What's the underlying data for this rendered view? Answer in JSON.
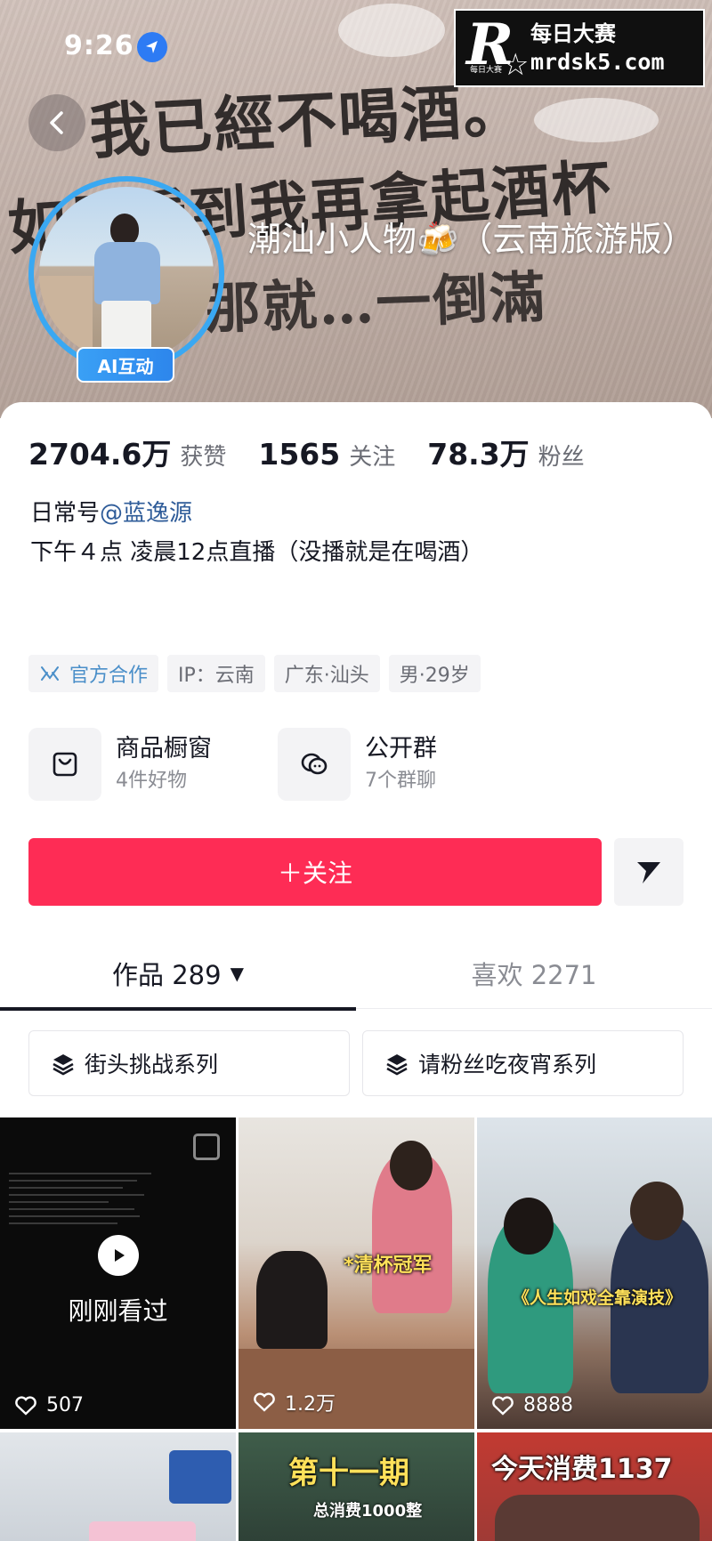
{
  "status_bar": {
    "time": "9:26"
  },
  "watermark": {
    "line1": "每日大赛",
    "line2": "mrdsk5.com",
    "logo_small": "每日大赛"
  },
  "banner": {
    "graffiti": [
      "我已經不喝酒。",
      "如果看到我再拿起酒杯",
      "那就…一倒滿"
    ],
    "nickname": "潮汕小人物🍻（云南旅游版）",
    "ai_badge": "AI互动"
  },
  "stats": [
    {
      "value": "2704.6万",
      "label": "获赞"
    },
    {
      "value": "1565",
      "label": "关注"
    },
    {
      "value": "78.3万",
      "label": "粉丝"
    }
  ],
  "profile": {
    "daily_prefix": "日常号",
    "daily_handle": "@蓝逸源",
    "bio": "下午４点 凌晨12点直播（没播就是在喝酒）"
  },
  "tags": [
    "官方合作",
    "IP：云南",
    "广东·汕头",
    "男·29岁"
  ],
  "entries": [
    {
      "title": "商品橱窗",
      "subtitle": "4件好物",
      "icon": "shop-bag-icon"
    },
    {
      "title": "公开群",
      "subtitle": "7个群聊",
      "icon": "group-chat-icon"
    }
  ],
  "actions": {
    "follow_label": "＋关注",
    "share_icon": "share-arrow-icon"
  },
  "tabs": {
    "works_label": "作品 289",
    "likes_label": "喜欢 2271"
  },
  "series": [
    "街头挑战系列",
    "请粉丝吃夜宵系列"
  ],
  "videos": [
    {
      "likes": "507",
      "overlay": "刚刚看过"
    },
    {
      "likes": "1.2万",
      "caption": "*清杯冠军"
    },
    {
      "likes": "8888",
      "caption": "《人生如戏全靠演技》"
    },
    {
      "caption": ""
    },
    {
      "caption": "第十一期",
      "sub_caption": "总消费1000整"
    },
    {
      "caption": "今天消费1137"
    }
  ],
  "colors": {
    "follow_red": "#fe2c55",
    "ai_blue": "#3aa8f2",
    "link_blue": "#2f5c99"
  }
}
